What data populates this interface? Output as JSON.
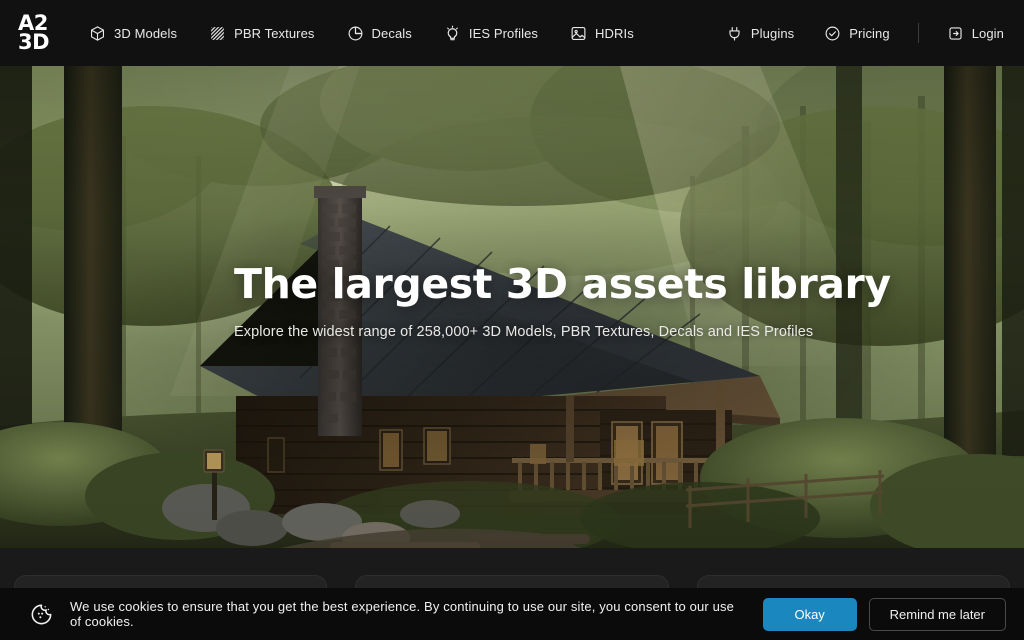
{
  "brand": {
    "logo_line1": "A2",
    "logo_line2": "3D"
  },
  "nav": {
    "left_items": [
      {
        "label": "3D Models",
        "icon": "cube-icon"
      },
      {
        "label": "PBR Textures",
        "icon": "texture-hatch-icon"
      },
      {
        "label": "Decals",
        "icon": "decal-circle-icon"
      },
      {
        "label": "IES Profiles",
        "icon": "lightbulb-icon"
      },
      {
        "label": "HDRIs",
        "icon": "image-icon"
      }
    ],
    "right_items": [
      {
        "label": "Plugins",
        "icon": "plug-icon"
      },
      {
        "label": "Pricing",
        "icon": "check-circle-icon"
      },
      {
        "label": "Login",
        "icon": "sign-in-icon"
      }
    ]
  },
  "hero": {
    "title": "The largest 3D assets library",
    "subtitle": "Explore the widest range of 258,000+ 3D Models, PBR Textures, Decals and IES Profiles",
    "scene": "forest-log-cabin"
  },
  "cards": [
    {
      "name": "asset-card-1"
    },
    {
      "name": "asset-card-2"
    },
    {
      "name": "asset-card-3"
    }
  ],
  "cookie_banner": {
    "icon": "cookie-icon",
    "message": "We use cookies to ensure that you get the best experience. By continuing to use our site, you consent to our use of cookies.",
    "accept_label": "Okay",
    "later_label": "Remind me later"
  },
  "colors": {
    "nav_background": "#111111",
    "page_background": "#171717",
    "accent_blue": "#1a87bf",
    "banner_background": "#0b0b0b",
    "text_primary": "#ffffff",
    "text_muted": "#e8e8e8"
  }
}
